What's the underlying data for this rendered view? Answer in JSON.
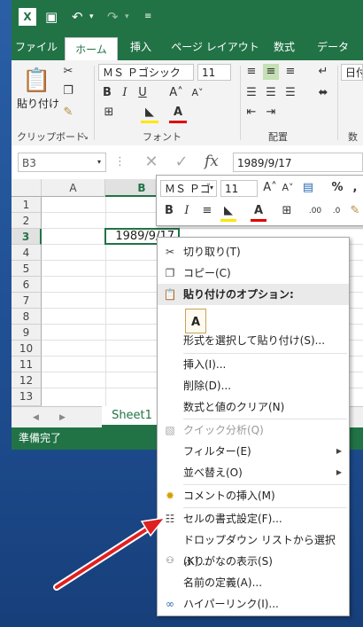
{
  "colors": {
    "excel_green": "#217346",
    "arrow_red": "#e02020",
    "desktop_blue": "#1f4f93"
  },
  "qat": {
    "app_icon": "excel-icon",
    "save_icon": "save-icon",
    "undo_icon": "undo-icon",
    "redo_icon": "redo-icon"
  },
  "ribbon_tabs": [
    "ファイル",
    "ホーム",
    "挿入",
    "ページ レイアウト",
    "数式",
    "データ"
  ],
  "ribbon": {
    "paste_label": "貼り付け",
    "clipboard_group": "クリップボード",
    "font_group": "フォント",
    "align_group": "配置",
    "number_group_partial": "数",
    "font_name": "ＭＳ Ｐゴシック",
    "font_size": "11",
    "number_format_partial": "日付"
  },
  "formula_bar": {
    "name_box": "B3",
    "fx": "fx",
    "value": "1989/9/17"
  },
  "mini_toolbar": {
    "font_name": "ＭＳ Ｐゴ",
    "font_size": "11",
    "percent": "%",
    "comma": ","
  },
  "columns": [
    "A",
    "B"
  ],
  "rows": [
    "1",
    "2",
    "3",
    "4",
    "5",
    "6",
    "7",
    "8",
    "9",
    "10",
    "11",
    "12",
    "13"
  ],
  "active_cell_value": "1989/9/17",
  "sheet_tab": "Sheet1",
  "status_text": "準備完了",
  "context_menu": {
    "cut": "切り取り(T)",
    "copy": "コピー(C)",
    "paste_options": "貼り付けのオプション:",
    "paste_special": "形式を選択して貼り付け(S)...",
    "insert": "挿入(I)...",
    "delete": "削除(D)...",
    "clear": "数式と値のクリア(N)",
    "quick_analysis": "クイック分析(Q)",
    "filter": "フィルター(E)",
    "sort": "並べ替え(O)",
    "insert_comment": "コメントの挿入(M)",
    "format_cells": "セルの書式設定(F)...",
    "dropdown_pick": "ドロップダウン リストから選択(K)...",
    "phonetic": "ふりがなの表示(S)",
    "define_name": "名前の定義(A)...",
    "hyperlink": "ハイパーリンク(I)..."
  }
}
